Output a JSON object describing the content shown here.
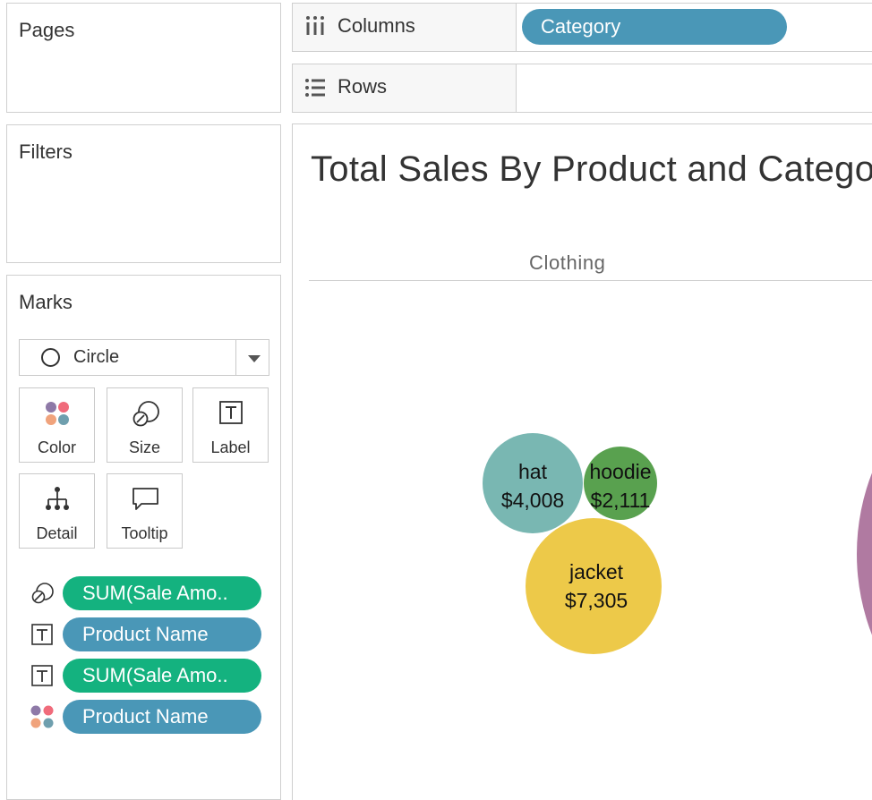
{
  "pages": {
    "title": "Pages"
  },
  "filters": {
    "title": "Filters"
  },
  "marks": {
    "title": "Marks",
    "mark_type": "Circle",
    "buttons": [
      "Color",
      "Size",
      "Label",
      "Detail",
      "Tooltip"
    ],
    "pills": [
      {
        "icon": "size-icon",
        "label": "SUM(Sale Amo..",
        "color": "#14b27f"
      },
      {
        "icon": "label-icon",
        "label": "Product Name",
        "color": "#4a97b7"
      },
      {
        "icon": "label-icon",
        "label": "SUM(Sale Amo..",
        "color": "#14b27f"
      },
      {
        "icon": "color-icon",
        "label": "Product Name",
        "color": "#4a97b7"
      }
    ]
  },
  "shelves": {
    "columns": {
      "label": "Columns",
      "pill": "Category"
    },
    "rows": {
      "label": "Rows"
    }
  },
  "viz": {
    "title": "Total Sales By Product and Category",
    "column_header": "Clothing"
  },
  "colors": {
    "dimension_pill": "#4a97b7",
    "measure_pill": "#14b27f",
    "hat": "#79b7b2",
    "hoodie": "#59a14f",
    "jacket": "#edc949",
    "fourth": "#b07aa1"
  },
  "chart_data": {
    "type": "packed-bubble",
    "title": "Total Sales By Product and Category",
    "category": "Clothing",
    "points": [
      {
        "product": "hat",
        "value": 4008,
        "label": "$4,008"
      },
      {
        "product": "hoodie",
        "value": 2111,
        "label": "$2,111"
      },
      {
        "product": "jacket",
        "value": 7305,
        "label": "$7,305"
      }
    ]
  }
}
